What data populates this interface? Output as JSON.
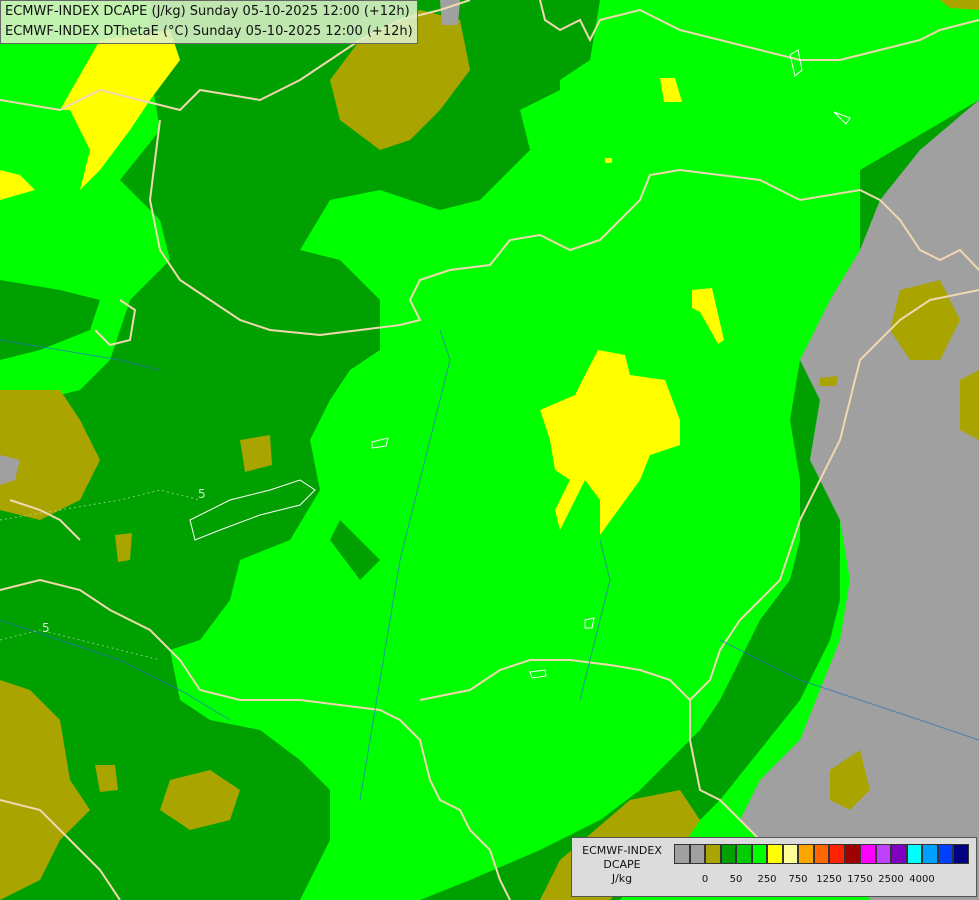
{
  "title": {
    "line1": "ECMWF-INDEX DCAPE (J/kg) Sunday 05-10-2025 12:00 (+12h)",
    "line2": "ECMWF-INDEX DThetaE (°C) Sunday 05-10-2025 12:00 (+12h)"
  },
  "contour_labels": [
    "5",
    "5"
  ],
  "legend": {
    "line1": "ECMWF-INDEX",
    "line2": "DCAPE",
    "line3": "J/kg",
    "colors": [
      "#a0a0a0",
      "#a0a0a0",
      "#aaa400",
      "#00a000",
      "#00cc00",
      "#00ff00",
      "#ffff00",
      "#ffff99",
      "#ffa500",
      "#ff6600",
      "#ff2200",
      "#a00000",
      "#ff00ff",
      "#c040ff",
      "#8000c0",
      "#00ffff",
      "#00a0ff",
      "#0040ff",
      "#000080"
    ],
    "tick_labels": [
      "0",
      "50",
      "250",
      "750",
      "1250",
      "1750",
      "2500",
      "4000"
    ]
  }
}
